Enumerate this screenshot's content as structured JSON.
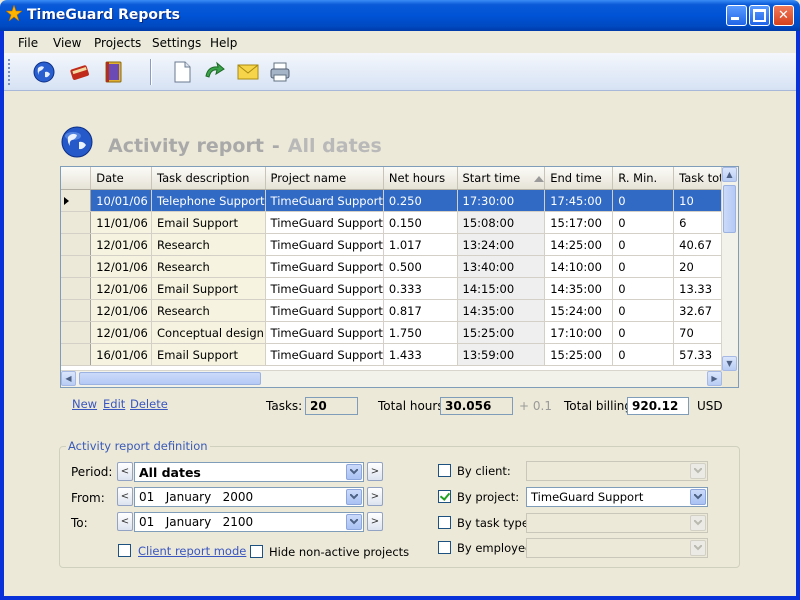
{
  "window": {
    "title": "TimeGuard Reports"
  },
  "menu": [
    "File",
    "View",
    "Projects",
    "Settings",
    "Help"
  ],
  "toolbar": [
    "globe-icon",
    "book-icon",
    "binder-icon",
    "new-document-icon",
    "refresh-icon",
    "email-icon",
    "print-icon"
  ],
  "report": {
    "title": "Activity report",
    "separator": "-",
    "subtitle": "All dates"
  },
  "grid": {
    "columns": [
      "Date",
      "Task description",
      "Project name",
      "Net hours",
      "Start time",
      "End time",
      "R. Min.",
      "Task total"
    ],
    "rows": [
      [
        "10/01/06",
        "Telephone Support",
        "TimeGuard Support",
        "0.250",
        "17:30:00",
        "17:45:00",
        "0",
        "10"
      ],
      [
        "11/01/06",
        "Email Support",
        "TimeGuard Support",
        "0.150",
        "15:08:00",
        "15:17:00",
        "0",
        "6"
      ],
      [
        "12/01/06",
        "Research",
        "TimeGuard Support",
        "1.017",
        "13:24:00",
        "14:25:00",
        "0",
        "40.67"
      ],
      [
        "12/01/06",
        "Research",
        "TimeGuard Support",
        "0.500",
        "13:40:00",
        "14:10:00",
        "0",
        "20"
      ],
      [
        "12/01/06",
        "Email Support",
        "TimeGuard Support",
        "0.333",
        "14:15:00",
        "14:35:00",
        "0",
        "13.33"
      ],
      [
        "12/01/06",
        "Research",
        "TimeGuard Support",
        "0.817",
        "14:35:00",
        "15:24:00",
        "0",
        "32.67"
      ],
      [
        "12/01/06",
        "Conceptual design",
        "TimeGuard Support",
        "1.750",
        "15:25:00",
        "17:10:00",
        "0",
        "70"
      ],
      [
        "16/01/06",
        "Email Support",
        "TimeGuard Support",
        "1.433",
        "13:59:00",
        "15:25:00",
        "0",
        "57.33"
      ]
    ],
    "selected_row": 0
  },
  "actions": {
    "new": "New",
    "edit": "Edit",
    "delete": "Delete"
  },
  "summary": {
    "tasks_label": "Tasks:",
    "tasks": "20",
    "hours_label": "Total hours:",
    "hours": "30.056",
    "hours_extra": "+ 0.1",
    "billing_label": "Total billing:",
    "billing": "920.12",
    "currency": "USD"
  },
  "definition": {
    "legend": "Activity report definition",
    "period_label": "Period:",
    "period": "All dates",
    "from_label": "From:",
    "from": "01   January   2000",
    "to_label": "To:",
    "to": "01   January   2100",
    "client_mode": "Client report mode",
    "hide_inactive": "Hide non-active projects",
    "by_client": "By client:",
    "by_client_checked": false,
    "by_client_value": "",
    "by_project": "By project:",
    "by_project_checked": true,
    "by_project_value": "TimeGuard Support",
    "by_task_type": "By task type:",
    "by_task_type_checked": false,
    "by_task_type_value": "",
    "by_employee": "By employee:",
    "by_employee_checked": false,
    "by_employee_value": ""
  }
}
